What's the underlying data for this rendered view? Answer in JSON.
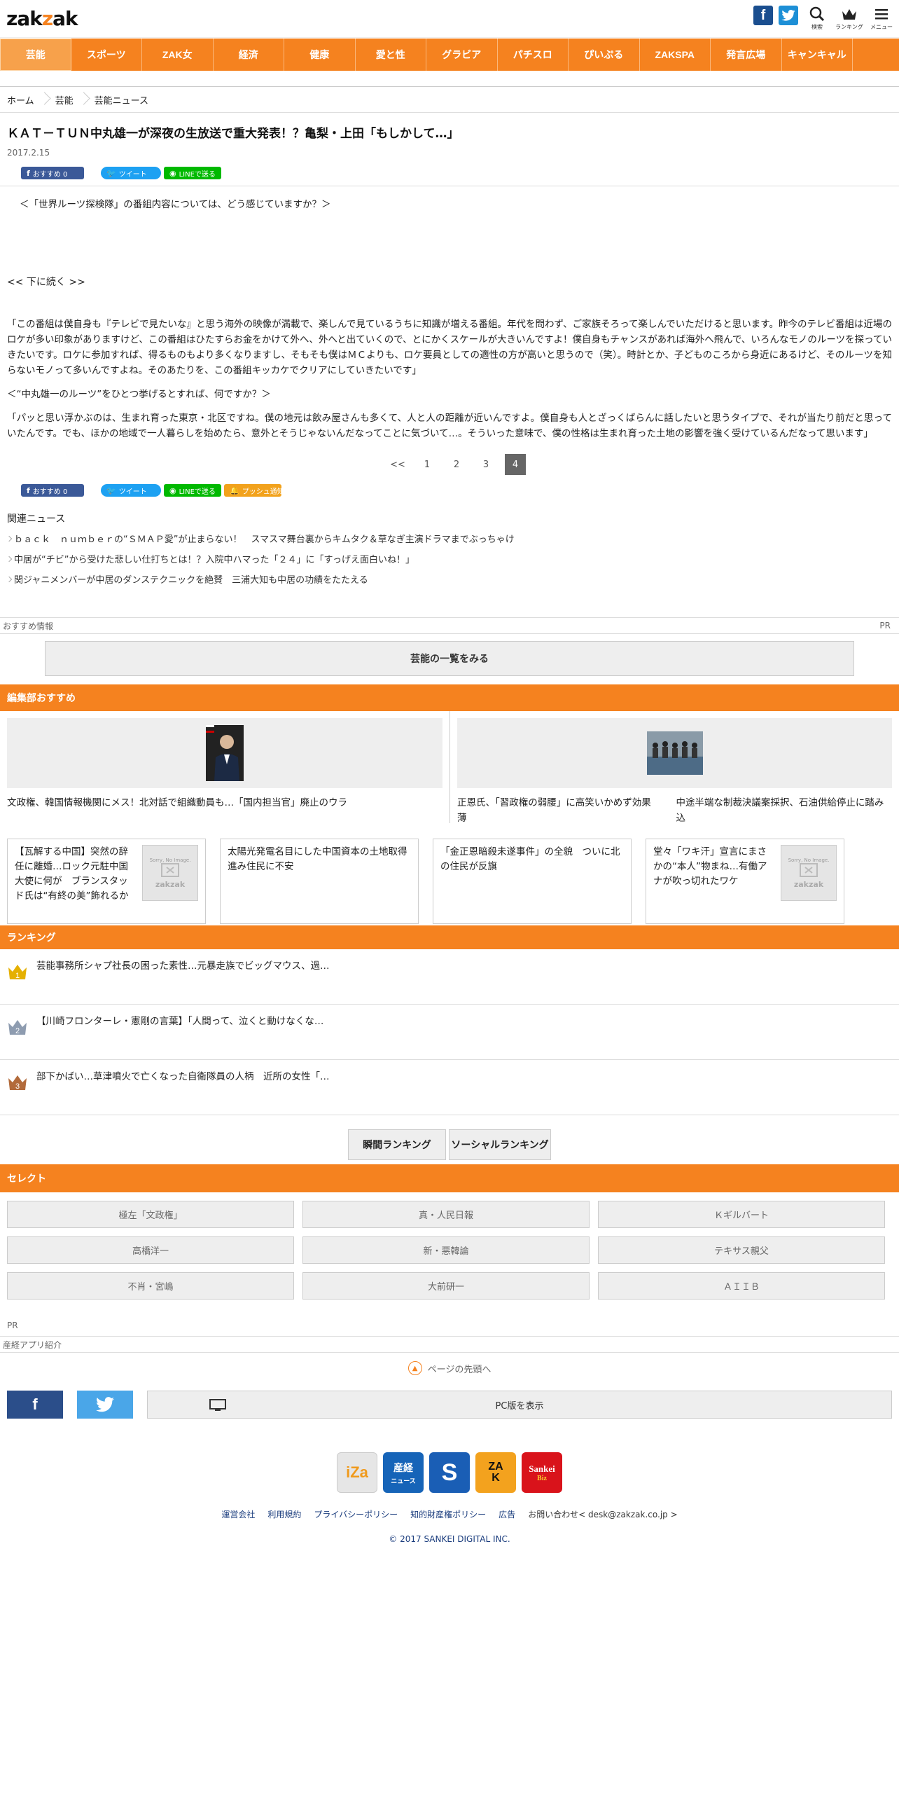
{
  "header": {
    "logo_main": "zak",
    "logo_accent": "z",
    "logo_tail": "ak",
    "fb_glyph": "f",
    "search_label": "検索",
    "ranking_label": "ランキング",
    "menu_label": "メニュー"
  },
  "nav": {
    "items": [
      {
        "label": "芸能",
        "active": true
      },
      {
        "label": "スポーツ"
      },
      {
        "label": "ZAK女"
      },
      {
        "label": "経済"
      },
      {
        "label": "健康"
      },
      {
        "label": "愛と性"
      },
      {
        "label": "グラビア"
      },
      {
        "label": "パチスロ"
      },
      {
        "label": "ぴいぷる"
      },
      {
        "label": "ZAKSPA"
      },
      {
        "label": "発言広場"
      },
      {
        "label": "キャンキャル"
      }
    ]
  },
  "breadcrumb": [
    "ホーム",
    "芸能",
    "芸能ニュース"
  ],
  "article": {
    "title": "ＫＡＴ－ＴＵＮ中丸雄一が深夜の生放送で重大発表！？亀梨・上田「もしかして…」",
    "date": "2017.2.15",
    "share": {
      "fb": "おすすめ 0",
      "tw": "ツイート",
      "line": "LINEで送る",
      "push": "プッシュ通知"
    },
    "lead": "＜「世界ルーツ探検隊」の番組内容については、どう感じていますか？＞",
    "more": "<< 下に続く >>",
    "para1": "「この番組は僕自身も『テレビで見たいな』と思う海外の映像が満載で、楽しんで見ているうちに知識が増える番組。年代を問わず、ご家族そろって楽しんでいただけると思います。昨今のテレビ番組は近場のロケが多い印象がありますけど、この番組はひたすらお金をかけて外へ、外へと出ていくので、とにかくスケールが大きいんですよ！僕自身もチャンスがあれば海外へ飛んで、いろんなモノのルーツを探っていきたいです。ロケに参加すれば、得るものもより多くなりますし、そもそも僕はＭＣよりも、ロケ要員としての適性の方が高いと思うので（笑）。時計とか、子どものころから身近にあるけど、そのルーツを知らないモノって多いんですよね。そのあたりを、この番組キッカケでクリアにしていきたいです」",
    "question2": "＜“中丸雄一のルーツ”をひとつ挙げるとすれば、何ですか？＞",
    "para2": "「パッと思い浮かぶのは、生まれ育った東京・北区ですね。僕の地元は飲み屋さんも多くて、人と人の距離が近いんですよ。僕自身も人とざっくばらんに話したいと思うタイプで、それが当たり前だと思っていたんです。でも、ほかの地域で一人暮らしを始めたら、意外とそうじゃないんだなってことに気づいて…。そういった意味で、僕の性格は生まれ育った土地の影響を強く受けているんだなって思います」",
    "pager": [
      "<<",
      "1",
      "2",
      "3",
      "4"
    ],
    "pager_current": "4"
  },
  "related": {
    "title": "関連ニュース",
    "items": [
      "ｂａｃｋ　ｎｕｍｂｅｒの“ＳＭＡＰ愛”が止まらない！　スマスマ舞台裏からキムタク＆草なぎ主演ドラマまでぶっちゃけ",
      "中居が“チビ”から受けた悲しい仕打ちとは！？入院中ハマった「２４」に「すっげえ面白いね！」",
      "関ジャニメンバーが中居のダンステクニックを絶賛　三浦大知も中居の功績をたたえる"
    ]
  },
  "recommend_bar": {
    "left": "おすすめ情報",
    "right": "PR"
  },
  "list_button": "芸能の一覧をみる",
  "editor": {
    "heading": "編集部おすすめ",
    "picks": [
      {
        "text": "文政権、韓国情報機関にメス！北対話で組織動員も…「国内担当官」廃止のウラ"
      },
      {
        "text_a": "正恩氏、「習政権の弱腰」に高笑いかめず効果薄",
        "text_b": "中途半端な制裁決議案採択、石油供給停止に踏み込"
      }
    ],
    "cards": [
      {
        "text": "【瓦解する中国】突然の辞任に離婚…ロック元駐中国大使に何が　ブランスタッド氏は“有終の美”飾れるか",
        "img": true
      },
      {
        "text": "太陽光発電名目にした中国資本の土地取得進み住民に不安",
        "img": false
      },
      {
        "text": "「金正恩暗殺未遂事件」の全貌　ついに北の住民が反旗",
        "img": false
      },
      {
        "text": "堂々「ワキ汗」宣言にまさかの“本人”物まね…有働アナが吹っ切れたワケ",
        "img": true
      }
    ],
    "noimg_t1": "Sorry, No Image.",
    "noimg_t2": "zakzak"
  },
  "ranking": {
    "heading": "ランキング",
    "items": [
      {
        "rank": "1",
        "text": "芸能事務所シャプ社長の困った素性…元暴走族でビッグマウス、過…"
      },
      {
        "rank": "2",
        "text": "【川崎フロンターレ・憲剛の言葉】「人間って、泣くと動けなくな…"
      },
      {
        "rank": "3",
        "text": "部下かばい…草津噴火で亡くなった自衛隊員の人柄　近所の女性「…"
      }
    ],
    "tabs": [
      "瞬間ランキング",
      "ソーシャルランキング"
    ]
  },
  "select": {
    "heading": "セレクト",
    "items": [
      "極左「文政権」",
      "真・人民日報",
      "Ｋギルバート",
      "高橋洋一",
      "新・悪韓論",
      "テキサス親父",
      "不肖・宮嶋",
      "大前研一",
      "ＡＩＩＢ"
    ]
  },
  "footer": {
    "pr": "PR",
    "app_intro": "産経アプリ紹介",
    "to_top": "ページの先頭へ",
    "fb_glyph": "f",
    "pc_label": "PC版を表示",
    "logos": {
      "iza": "iZa",
      "sankei": "産経",
      "sankei_sub": "ニュース",
      "sanspo": "S",
      "zak": "ZA\nK",
      "biz": "Sankei",
      "biz_sub": "Biz"
    },
    "links": [
      "運営会社",
      "利用規約",
      "プライバシーポリシー",
      "知的財産権ポリシー",
      "広告"
    ],
    "contact": "お問い合わせ< desk@zakzak.co.jp >",
    "copyright": "© 2017 SANKEI DIGITAL INC."
  },
  "colors": {
    "brand_orange": "#f5821f",
    "fb_blue": "#3b5998",
    "tw_blue": "#1da1f2",
    "line_green": "#00b900"
  }
}
